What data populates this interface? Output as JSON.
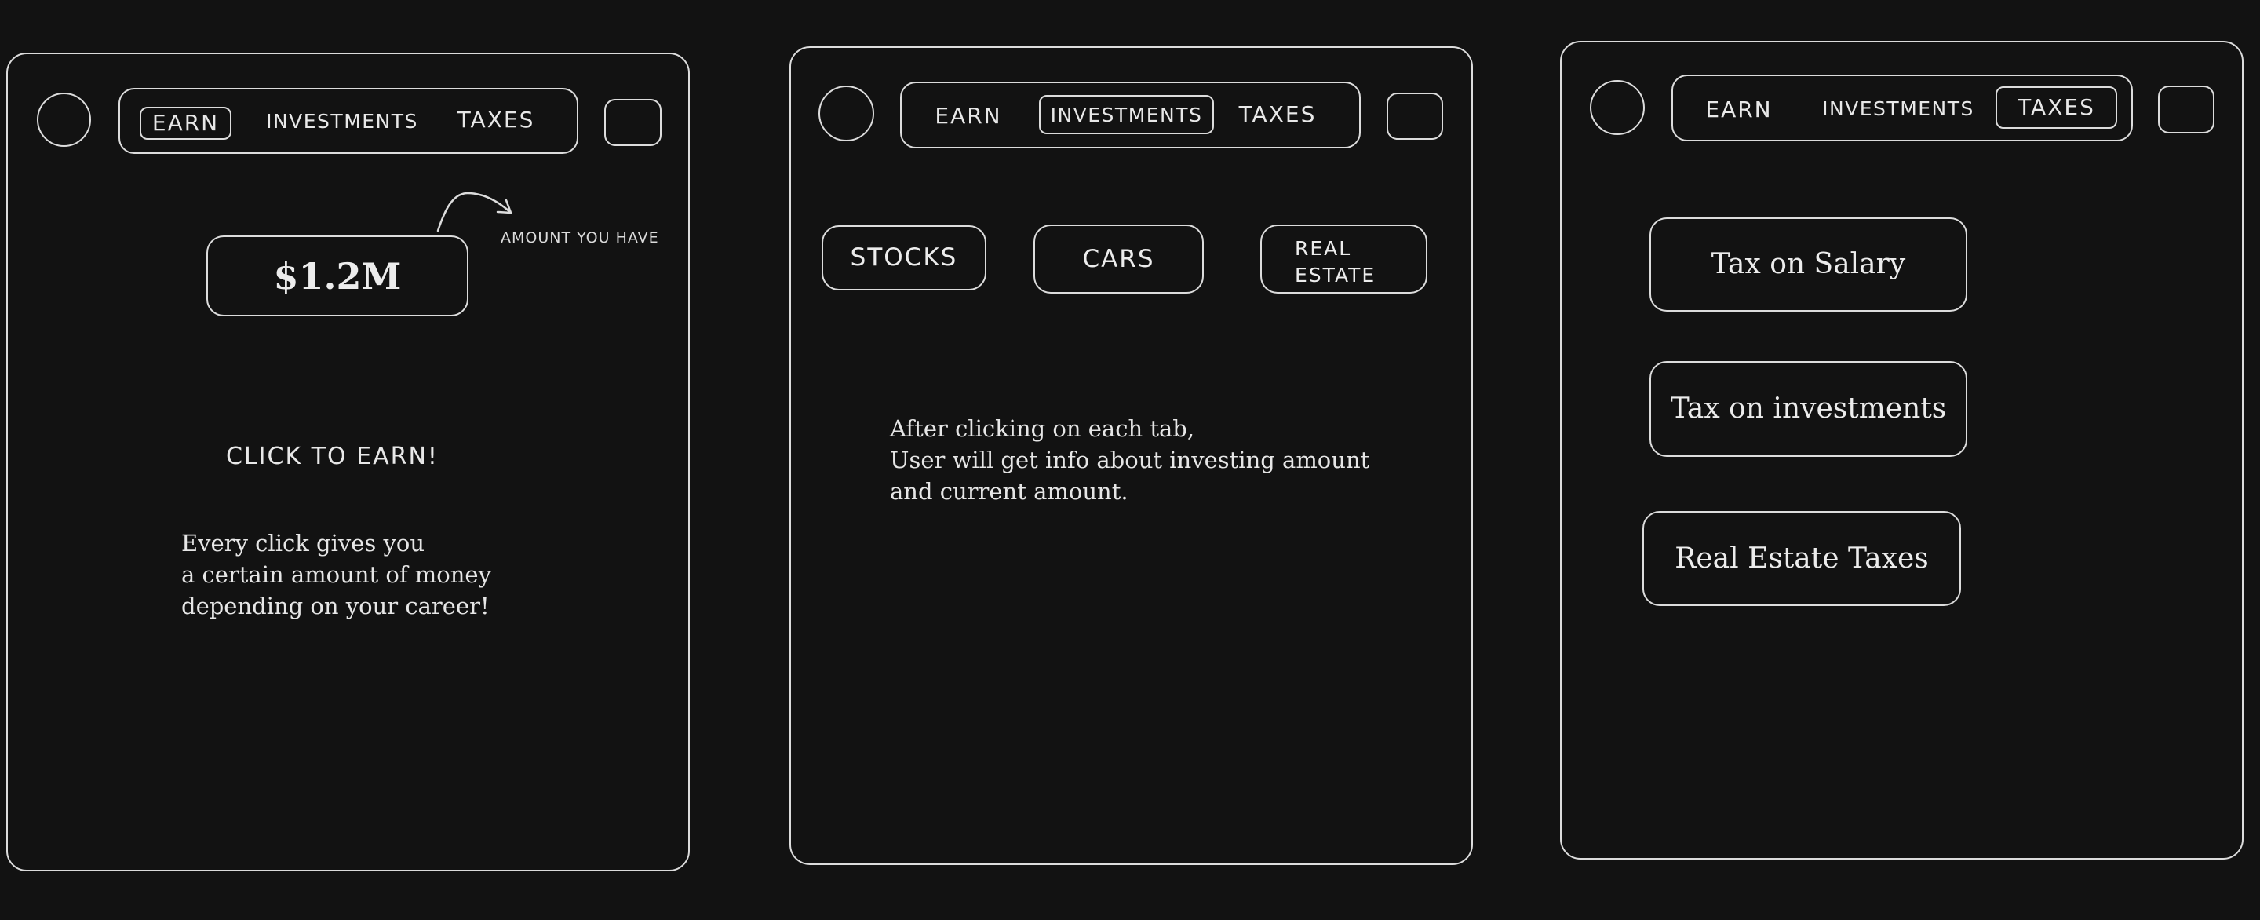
{
  "screens": {
    "earn": {
      "tabs": [
        "EARN",
        "INVESTMENTS",
        "TAXES"
      ],
      "active_tab": "EARN",
      "balance": "$1.2M",
      "balance_annotation": "AMOUNT YOU HAVE",
      "cta": "CLICK TO EARN!",
      "description": [
        "Every click gives you",
        "a certain amount of money",
        "depending on your career!"
      ]
    },
    "investments": {
      "tabs": [
        "EARN",
        "INVESTMENTS",
        "TAXES"
      ],
      "active_tab": "INVESTMENTS",
      "options": [
        "STOCKS",
        "CARS",
        "REAL",
        "ESTATE"
      ],
      "note": [
        "After clicking on each tab,",
        "User will get info about investing amount",
        "and current amount."
      ]
    },
    "taxes": {
      "tabs": [
        "EARN",
        "INVESTMENTS",
        "TAXES"
      ],
      "active_tab": "TAXES",
      "buttons": [
        "Tax on Salary",
        "Tax on investments",
        "Real Estate Taxes"
      ]
    }
  },
  "colors": {
    "background": "#121212",
    "stroke": "#dcdcdc",
    "text": "#e6e6e6"
  }
}
